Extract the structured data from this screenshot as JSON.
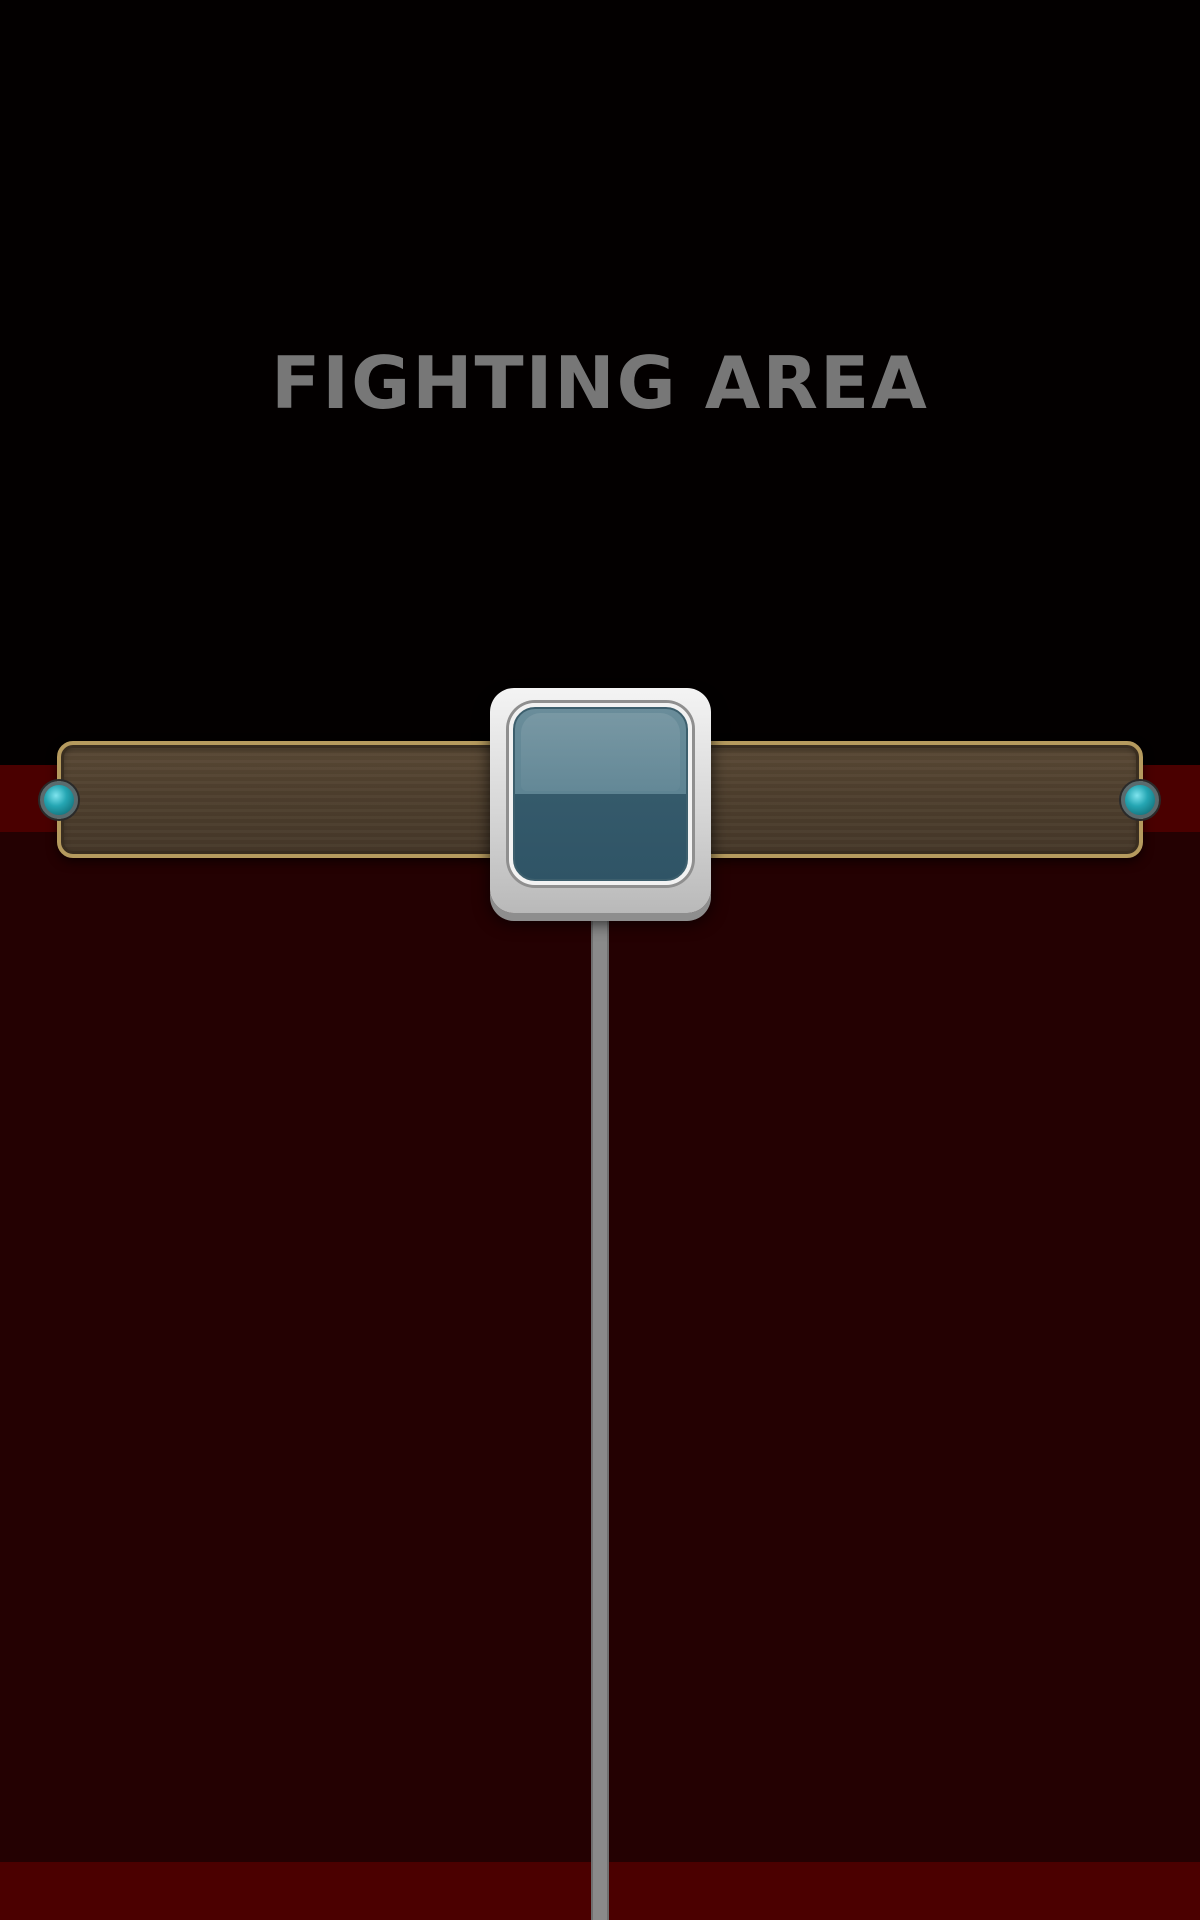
{
  "screen": {
    "title": "FIGHTING AREA"
  },
  "colors": {
    "background_top": "#030000",
    "background_lower": "#240102",
    "band_red": "#4a0000",
    "title_gray": "#777777",
    "gem_teal": "#25a6b3",
    "wood_border": "#b59a5e"
  },
  "icons": {
    "left_gem": "teal-gem-icon",
    "right_gem": "teal-gem-icon",
    "center_slot": "empty-item-slot"
  }
}
